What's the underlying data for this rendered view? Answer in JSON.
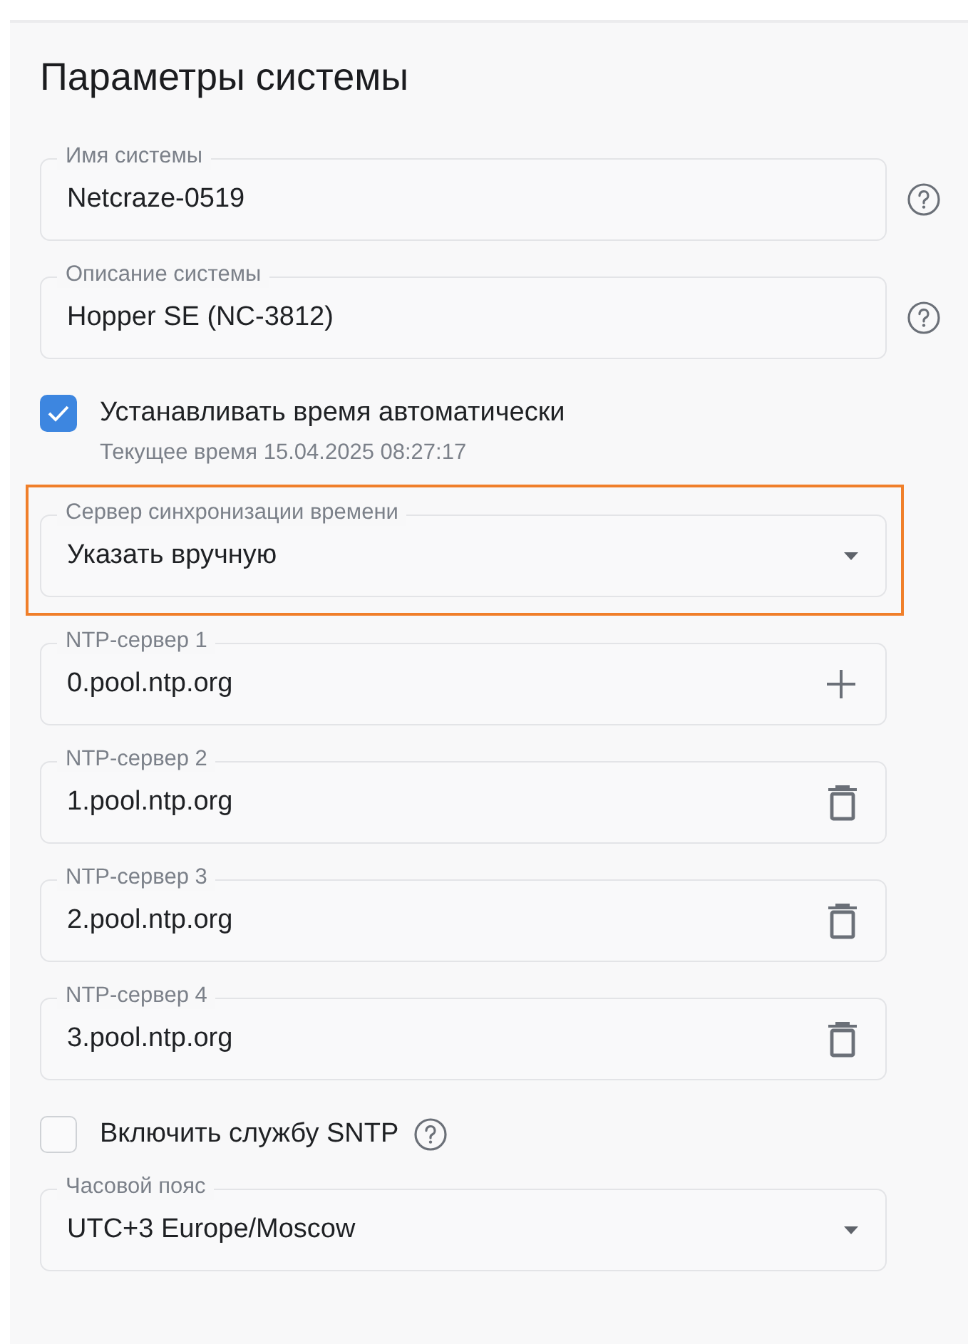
{
  "title": "Параметры системы",
  "items": [
    {
      "kind": "field",
      "label": "Имя системы",
      "value": "Netcraze-0519",
      "help": true,
      "highlighted": false
    },
    {
      "kind": "field",
      "label": "Описание системы",
      "value": "Hopper SE (NC-3812)",
      "help": true,
      "highlighted": false
    },
    {
      "kind": "checkbox",
      "label": "Устанавливать время автоматически",
      "hint": "Текущее время 15.04.2025 08:27:17",
      "checked": true,
      "help": false
    },
    {
      "kind": "select",
      "label": "Сервер синхронизации времени",
      "value": "Указать вручную",
      "help": false,
      "highlighted": true
    },
    {
      "kind": "field",
      "label": "NTP-сервер 1",
      "value": "0.pool.ntp.org",
      "button": {
        "kind": "add"
      },
      "help": false,
      "highlighted": false
    },
    {
      "kind": "field",
      "label": "NTP-сервер 2",
      "value": "1.pool.ntp.org",
      "button": {
        "kind": "delete"
      },
      "help": false,
      "highlighted": false
    },
    {
      "kind": "field",
      "label": "NTP-сервер 3",
      "value": "2.pool.ntp.org",
      "button": {
        "kind": "delete"
      },
      "help": false,
      "highlighted": false
    },
    {
      "kind": "field",
      "label": "NTP-сервер 4",
      "value": "3.pool.ntp.org",
      "button": {
        "kind": "delete"
      },
      "help": false,
      "highlighted": false
    },
    {
      "kind": "checkbox",
      "label": "Включить службу SNTP",
      "checked": false,
      "help": true
    },
    {
      "kind": "select",
      "label": "Часовой пояс",
      "value": "UTC+3 Europe/Moscow",
      "help": false,
      "highlighted": false
    }
  ]
}
